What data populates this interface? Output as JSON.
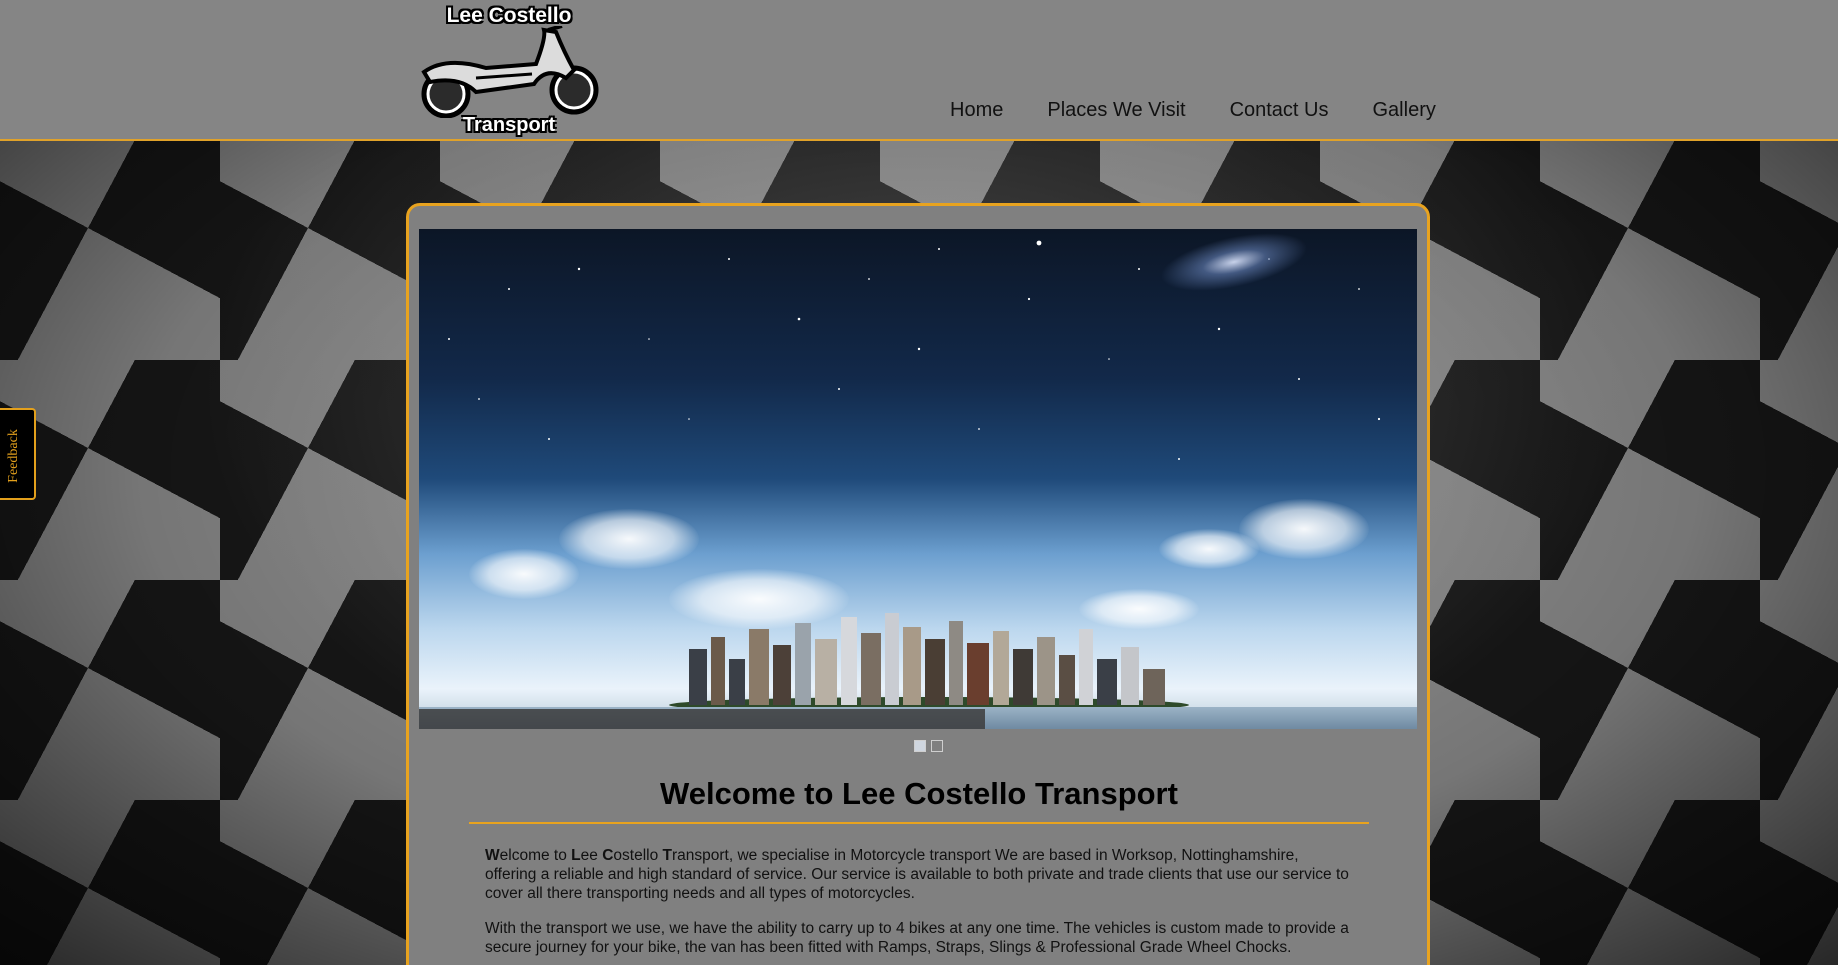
{
  "site": {
    "logo_title": "Lee Costello",
    "logo_sub": "Transport"
  },
  "nav": {
    "items": [
      {
        "label": "Home"
      },
      {
        "label": "Places We Visit"
      },
      {
        "label": "Contact Us"
      },
      {
        "label": "Gallery"
      }
    ]
  },
  "slider": {
    "slides": 2,
    "active_slide": 1
  },
  "main": {
    "title": "Welcome to Lee Costello Transport",
    "para1_rest": "ransport, we specialise in Motorcycle transport We are based in Worksop, Nottinghamshire, offering a reliable and high standard of service. Our service is available to both private and trade clients that use our service to cover all there transporting needs and all types of motorcycles.",
    "para2": "With the transport we use, we have the ability to carry up to 4 bikes at any one time. The vehicles is custom made to provide a secure journey for your bike, the van has been fitted with Ramps, Straps, Slings & Professional Grade Wheel Chocks."
  },
  "feedback": {
    "label": "Feedback"
  },
  "colors": {
    "accent": "#e8a31f",
    "header_bg": "#858585",
    "panel_bg": "#808080"
  },
  "icons": [
    "motorcycle-logo-icon"
  ]
}
